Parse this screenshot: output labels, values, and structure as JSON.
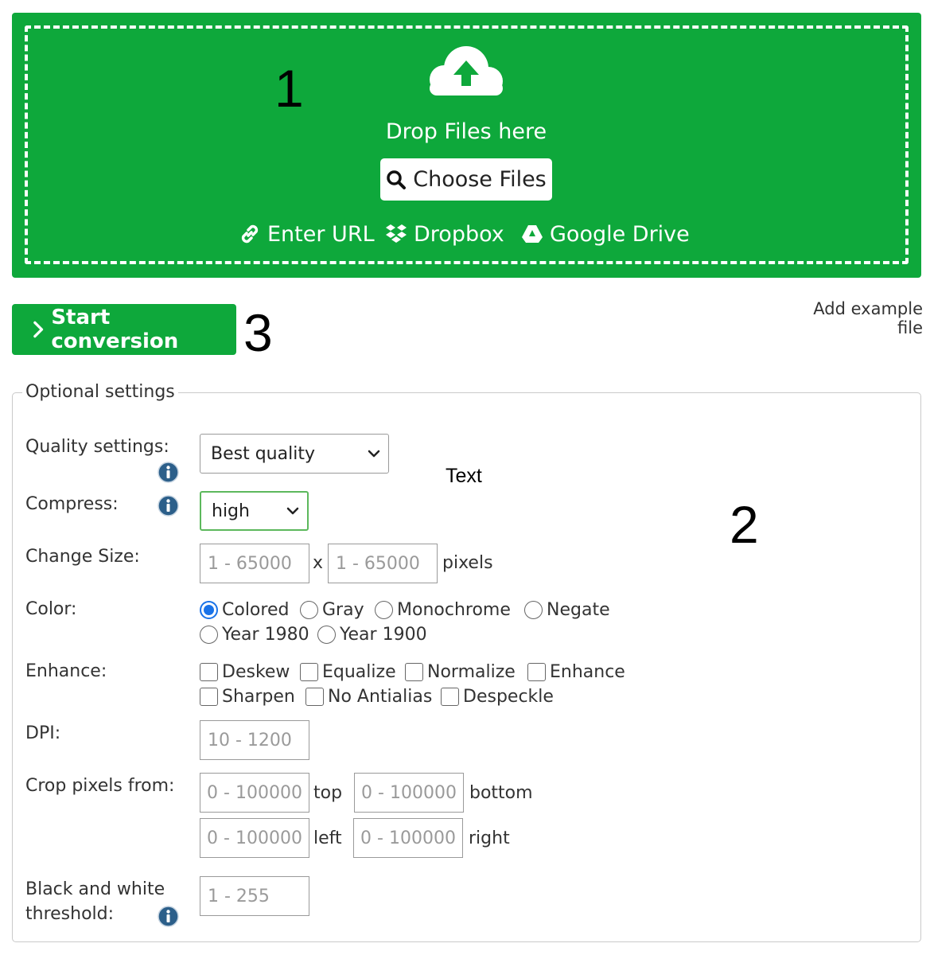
{
  "upload": {
    "drop_text": "Drop Files here",
    "choose_label": "Choose Files",
    "sources": {
      "url": "Enter URL",
      "dropbox": "Dropbox",
      "google_drive": "Google Drive"
    },
    "icons": {
      "upload": "cloud-upload-icon",
      "search": "search-icon",
      "link": "link-icon",
      "dropbox": "dropbox-icon",
      "drive": "google-drive-icon"
    },
    "background_color": "#0ea83b"
  },
  "annotations": {
    "one": "1",
    "two": "2",
    "three": "3",
    "text": "Text"
  },
  "actions": {
    "start_label": "Start conversion",
    "add_example": "Add example file"
  },
  "settings": {
    "legend": "Optional settings",
    "quality": {
      "label": "Quality settings:",
      "value": "Best quality"
    },
    "compress": {
      "label": "Compress:",
      "value": "high"
    },
    "size": {
      "label": "Change Size:",
      "width_placeholder": "1 - 65000",
      "separator": "x",
      "height_placeholder": "1 - 65000",
      "unit": "pixels"
    },
    "color": {
      "label": "Color:",
      "options": [
        "Colored",
        "Gray",
        "Monochrome",
        "Negate",
        "Year 1980",
        "Year 1900"
      ],
      "selected": "Colored"
    },
    "enhance": {
      "label": "Enhance:",
      "options": [
        "Deskew",
        "Equalize",
        "Normalize",
        "Enhance",
        "Sharpen",
        "No Antialias",
        "Despeckle"
      ]
    },
    "dpi": {
      "label": "DPI:",
      "placeholder": "10 - 1200"
    },
    "crop": {
      "label": "Crop pixels from:",
      "placeholder": "0 - 100000",
      "top": "top",
      "bottom": "bottom",
      "left": "left",
      "right": "right"
    },
    "threshold": {
      "label_line1": "Black and white",
      "label_line2": "threshold:",
      "placeholder": "1 - 255"
    }
  }
}
